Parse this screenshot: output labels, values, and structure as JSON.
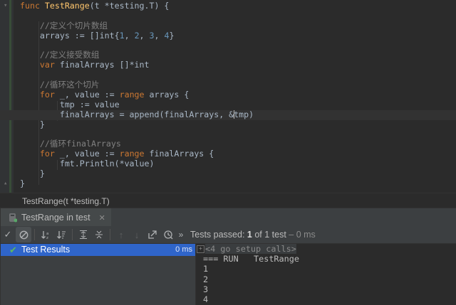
{
  "editor": {
    "lines": [
      {
        "tokens": [
          [
            "kw",
            "func "
          ],
          [
            "fn",
            "TestRange"
          ],
          [
            "ty",
            "(t *testing.T) {"
          ]
        ]
      },
      {
        "tokens": []
      },
      {
        "tokens": [
          [
            "cm",
            "    //定义个切片数组"
          ]
        ]
      },
      {
        "tokens": [
          [
            "ty",
            "    arrays := []int{"
          ],
          [
            "num",
            "1"
          ],
          [
            "ty",
            ", "
          ],
          [
            "num",
            "2"
          ],
          [
            "ty",
            ", "
          ],
          [
            "num",
            "3"
          ],
          [
            "ty",
            ", "
          ],
          [
            "num",
            "4"
          ],
          [
            "ty",
            "}"
          ]
        ]
      },
      {
        "tokens": []
      },
      {
        "tokens": [
          [
            "cm",
            "    //定义接受数组"
          ]
        ]
      },
      {
        "tokens": [
          [
            "kw",
            "    var "
          ],
          [
            "ty",
            "finalArrays []*int"
          ]
        ]
      },
      {
        "tokens": []
      },
      {
        "tokens": [
          [
            "cm",
            "    //循环这个切片"
          ]
        ]
      },
      {
        "tokens": [
          [
            "kw",
            "    for "
          ],
          [
            "ty",
            "_, value := "
          ],
          [
            "kw",
            "range "
          ],
          [
            "ty",
            "arrays {"
          ]
        ]
      },
      {
        "tokens": [
          [
            "ty",
            "        tmp := value"
          ]
        ]
      },
      {
        "tokens": [
          [
            "ty",
            "        finalArrays = append(finalArrays, &"
          ],
          [
            "caret",
            ""
          ],
          [
            "ty",
            "tmp)"
          ]
        ],
        "current": true
      },
      {
        "tokens": [
          [
            "ty",
            "    }"
          ]
        ]
      },
      {
        "tokens": []
      },
      {
        "tokens": [
          [
            "cm",
            "    //循环finalArrays"
          ]
        ]
      },
      {
        "tokens": [
          [
            "kw",
            "    for "
          ],
          [
            "ty",
            "_, value := "
          ],
          [
            "kw",
            "range "
          ],
          [
            "ty",
            "finalArrays {"
          ]
        ]
      },
      {
        "tokens": [
          [
            "ty",
            "        fmt.Println(*value)"
          ]
        ]
      },
      {
        "tokens": [
          [
            "ty",
            "    }"
          ]
        ]
      },
      {
        "tokens": [
          [
            "ty",
            "}"
          ]
        ]
      }
    ]
  },
  "breadcrumb": {
    "text": "TestRange(t *testing.T)"
  },
  "run": {
    "tab_label": "TestRange in test",
    "status": {
      "prefix": "Tests passed: ",
      "passed": "1",
      "of_text": " of 1 test",
      "duration": " – 0 ms"
    },
    "results": {
      "label": "Test Results",
      "time": "0 ms"
    },
    "console": {
      "setup": "<4 go setup calls>",
      "lines": [
        "=== RUN   TestRange",
        "1",
        "2",
        "3",
        "4"
      ]
    }
  },
  "colors": {
    "keyword": "#cc7832",
    "function": "#ffc66d",
    "comment": "#808080",
    "number": "#6897bb",
    "selection": "#2f65ca",
    "pass": "#5fb760"
  },
  "icons": [
    "fold-icon",
    "run-config-icon",
    "close-icon",
    "check-icon",
    "stop-icon",
    "sort-alpha-icon",
    "sort-duration-icon",
    "expand-all-icon",
    "collapse-all-icon",
    "previous-icon",
    "next-icon",
    "export-icon",
    "history-icon",
    "more-icon",
    "pass-check-icon",
    "expand-setup-icon"
  ]
}
